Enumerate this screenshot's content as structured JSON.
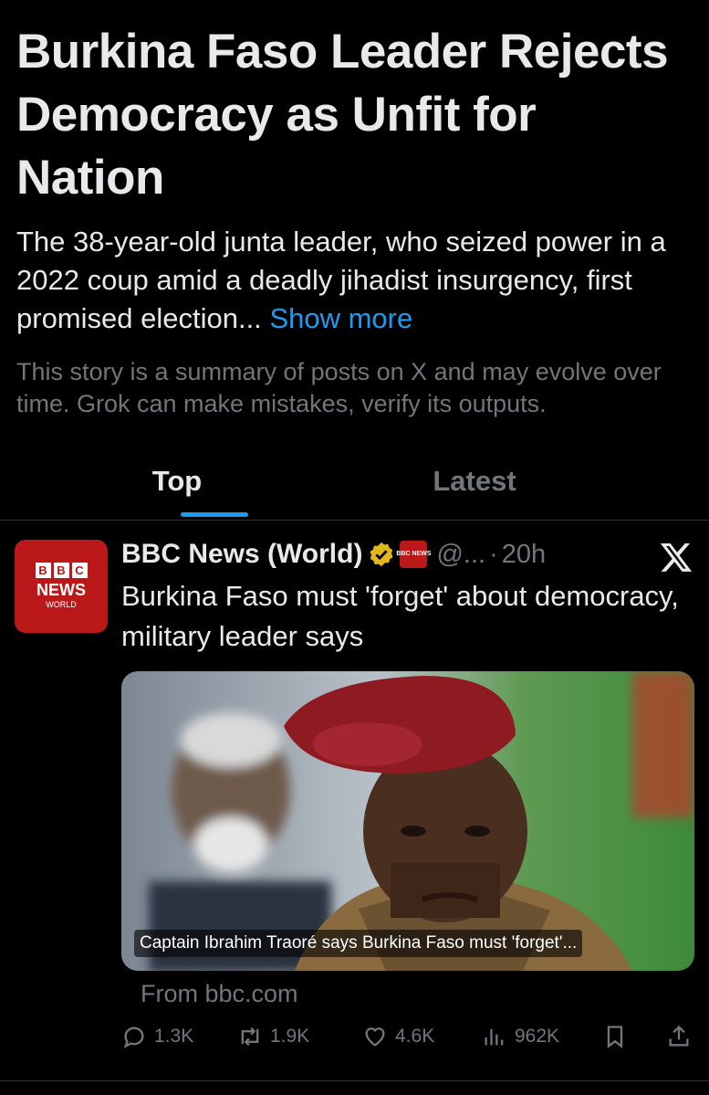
{
  "story": {
    "headline": "Burkina Faso Leader Rejects Democracy as Unfit for Nation",
    "summary": "The 38-year-old junta leader, who seized power in a 2022 coup amid a deadly jihadist insurgency, first promised election...",
    "show_more": "Show more",
    "disclaimer": "This story is a summary of posts on X and may evolve over time. Grok can make mistakes, verify its outputs."
  },
  "tabs": [
    {
      "label": "Top",
      "active": true
    },
    {
      "label": "Latest",
      "active": false
    }
  ],
  "post": {
    "avatar": {
      "bbc": [
        "B",
        "B",
        "C"
      ],
      "news": "NEWS",
      "world": "WORLD"
    },
    "author": "BBC News (World)",
    "affiliation_badge": "BBC NEWS",
    "handle": "@...",
    "separator": "·",
    "time": "20h",
    "text": "Burkina Faso must 'forget' about democracy, military leader says",
    "media_caption": "Captain Ibrahim Traoré says Burkina Faso must 'forget'...",
    "source": "From bbc.com",
    "metrics": {
      "replies": "1.3K",
      "reposts": "1.9K",
      "likes": "4.6K",
      "views": "962K"
    },
    "icons": [
      "verified-icon",
      "x-logo-icon",
      "reply-icon",
      "repost-icon",
      "like-icon",
      "views-icon",
      "bookmark-icon",
      "share-icon"
    ]
  },
  "colors": {
    "background": "#000000",
    "text": "#e7e9ea",
    "muted": "#71767b",
    "accent": "#1d9bf0",
    "bbc_red": "#bb1919",
    "verified_gold": "#e2b719"
  }
}
